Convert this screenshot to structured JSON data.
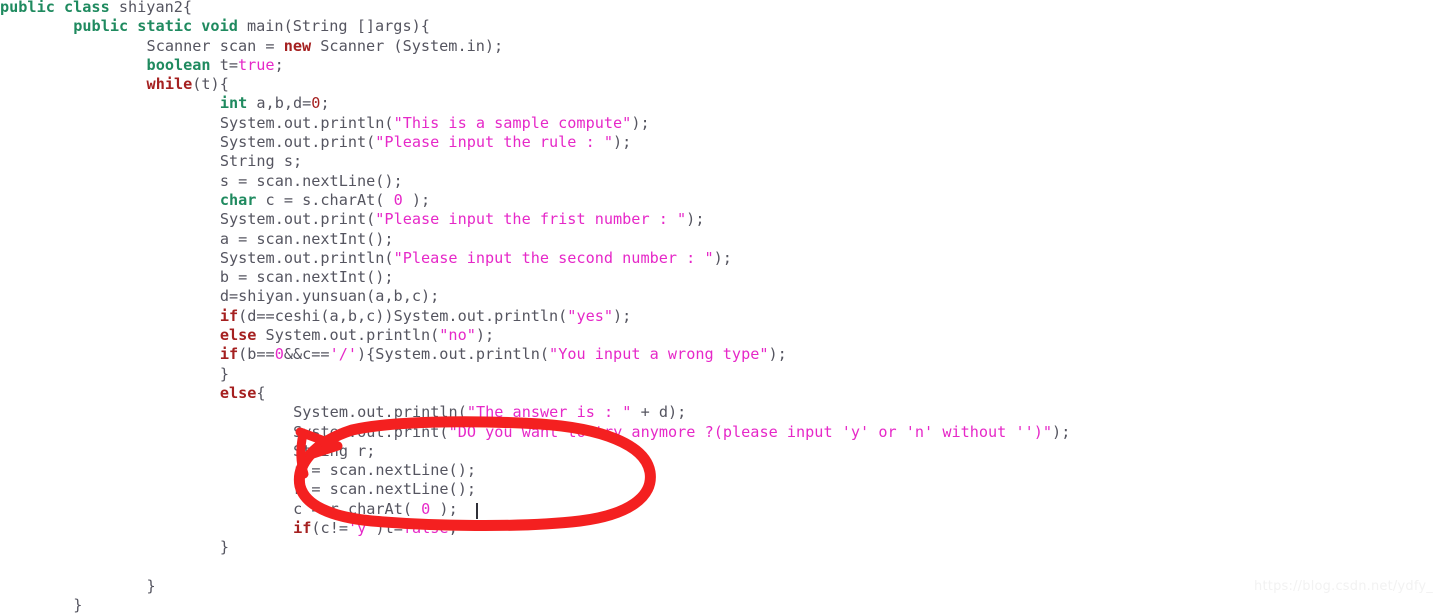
{
  "window": {
    "title": "shiyan2.java",
    "kind": "code-editor-screenshot",
    "background": "#ffffff"
  },
  "theme": {
    "foreground": "#555560",
    "keyword_type": "#1f8a5f",
    "keyword_control": "#a52020",
    "string": "#e628c8",
    "number": "#a52020",
    "caret": "#303038",
    "annotation": "#f42020",
    "watermark": "#f2f2f2"
  },
  "editor": {
    "language": "Java",
    "font_size_px": 15.2,
    "line_height_px": 19.3,
    "caret": {
      "line_index": 27,
      "after_text": "r = scan.nextLine();"
    },
    "lines": [
      {
        "n": 1,
        "indent": 0,
        "text": "public class shiyan2{",
        "tokens": [
          {
            "t": "public class ",
            "c": "kw"
          },
          {
            "t": "shiyan2{",
            "c": "plain"
          }
        ]
      },
      {
        "n": 2,
        "indent": 8,
        "text": "public static void main(String []args){",
        "tokens": [
          {
            "t": "public static void ",
            "c": "kw"
          },
          {
            "t": "main(String []args){",
            "c": "plain"
          }
        ]
      },
      {
        "n": 3,
        "indent": 16,
        "text": "Scanner scan = new Scanner (System.in);",
        "tokens": [
          {
            "t": "Scanner scan = ",
            "c": "plain"
          },
          {
            "t": "new",
            "c": "kw2"
          },
          {
            "t": " Scanner (System.in);",
            "c": "plain"
          }
        ]
      },
      {
        "n": 4,
        "indent": 16,
        "text": "boolean t=true;",
        "tokens": [
          {
            "t": "boolean",
            "c": "kw"
          },
          {
            "t": " t=",
            "c": "plain"
          },
          {
            "t": "true",
            "c": "lit"
          },
          {
            "t": ";",
            "c": "plain"
          }
        ]
      },
      {
        "n": 5,
        "indent": 16,
        "text": "while(t){",
        "tokens": [
          {
            "t": "while",
            "c": "kw2"
          },
          {
            "t": "(t){",
            "c": "plain"
          }
        ]
      },
      {
        "n": 6,
        "indent": 24,
        "text": "int a,b,d=0;",
        "tokens": [
          {
            "t": "int",
            "c": "kw"
          },
          {
            "t": " a,b,d=",
            "c": "plain"
          },
          {
            "t": "0",
            "c": "num"
          },
          {
            "t": ";",
            "c": "plain"
          }
        ]
      },
      {
        "n": 7,
        "indent": 24,
        "text": "System.out.println(\"This is a sample compute\");",
        "tokens": [
          {
            "t": "System.out.println(",
            "c": "plain"
          },
          {
            "t": "\"This is a sample compute\"",
            "c": "str"
          },
          {
            "t": ");",
            "c": "plain"
          }
        ]
      },
      {
        "n": 8,
        "indent": 24,
        "text": "System.out.print(\"Please input the rule : \");",
        "tokens": [
          {
            "t": "System.out.print(",
            "c": "plain"
          },
          {
            "t": "\"Please input the rule : \"",
            "c": "str"
          },
          {
            "t": ");",
            "c": "plain"
          }
        ]
      },
      {
        "n": 9,
        "indent": 24,
        "text": "String s;",
        "tokens": [
          {
            "t": "String s;",
            "c": "plain"
          }
        ]
      },
      {
        "n": 10,
        "indent": 24,
        "text": "s = scan.nextLine();",
        "tokens": [
          {
            "t": "s = scan.nextLine();",
            "c": "plain"
          }
        ]
      },
      {
        "n": 11,
        "indent": 24,
        "text": "char c = s.charAt( 0 );",
        "tokens": [
          {
            "t": "char",
            "c": "kw"
          },
          {
            "t": " c = s.charAt( ",
            "c": "plain"
          },
          {
            "t": "0",
            "c": "numpink"
          },
          {
            "t": " );",
            "c": "plain"
          }
        ]
      },
      {
        "n": 12,
        "indent": 24,
        "text": "System.out.print(\"Please input the frist number : \");",
        "tokens": [
          {
            "t": "System.out.print(",
            "c": "plain"
          },
          {
            "t": "\"Please input the frist number : \"",
            "c": "str"
          },
          {
            "t": ");",
            "c": "plain"
          }
        ]
      },
      {
        "n": 13,
        "indent": 24,
        "text": "a = scan.nextInt();",
        "tokens": [
          {
            "t": "a = scan.nextInt();",
            "c": "plain"
          }
        ]
      },
      {
        "n": 14,
        "indent": 24,
        "text": "System.out.println(\"Please input the second number : \");",
        "tokens": [
          {
            "t": "System.out.println(",
            "c": "plain"
          },
          {
            "t": "\"Please input the second number : \"",
            "c": "str"
          },
          {
            "t": ");",
            "c": "plain"
          }
        ]
      },
      {
        "n": 15,
        "indent": 24,
        "text": "b = scan.nextInt();",
        "tokens": [
          {
            "t": "b = scan.nextInt();",
            "c": "plain"
          }
        ]
      },
      {
        "n": 16,
        "indent": 24,
        "text": "d=shiyan.yunsuan(a,b,c);",
        "tokens": [
          {
            "t": "d=shiyan.yunsuan(a,b,c);",
            "c": "plain"
          }
        ]
      },
      {
        "n": 17,
        "indent": 24,
        "text": "if(d==ceshi(a,b,c))System.out.println(\"yes\");",
        "tokens": [
          {
            "t": "if",
            "c": "kw2"
          },
          {
            "t": "(d==ceshi(a,b,c))System.out.println(",
            "c": "plain"
          },
          {
            "t": "\"yes\"",
            "c": "str"
          },
          {
            "t": ");",
            "c": "plain"
          }
        ]
      },
      {
        "n": 18,
        "indent": 24,
        "text": "else System.out.println(\"no\");",
        "tokens": [
          {
            "t": "else",
            "c": "kw2"
          },
          {
            "t": " System.out.println(",
            "c": "plain"
          },
          {
            "t": "\"no\"",
            "c": "str"
          },
          {
            "t": ");",
            "c": "plain"
          }
        ]
      },
      {
        "n": 19,
        "indent": 24,
        "text": "if(b==0&&c=='/'){System.out.println(\"You input a wrong type\");",
        "tokens": [
          {
            "t": "if",
            "c": "kw2"
          },
          {
            "t": "(b==",
            "c": "plain"
          },
          {
            "t": "0",
            "c": "numpink"
          },
          {
            "t": "&&c==",
            "c": "plain"
          },
          {
            "t": "'/'",
            "c": "str"
          },
          {
            "t": "){System.out.println(",
            "c": "plain"
          },
          {
            "t": "\"You input a wrong type\"",
            "c": "str"
          },
          {
            "t": ");",
            "c": "plain"
          }
        ]
      },
      {
        "n": 20,
        "indent": 24,
        "text": "}",
        "tokens": [
          {
            "t": "}",
            "c": "plain"
          }
        ]
      },
      {
        "n": 21,
        "indent": 24,
        "text": "else{",
        "tokens": [
          {
            "t": "else",
            "c": "kw2"
          },
          {
            "t": "{",
            "c": "plain"
          }
        ]
      },
      {
        "n": 22,
        "indent": 32,
        "text": "System.out.println(\"The answer is : \" + d);",
        "tokens": [
          {
            "t": "System.out.println(",
            "c": "plain"
          },
          {
            "t": "\"The answer is : \"",
            "c": "str"
          },
          {
            "t": " + d);",
            "c": "plain"
          }
        ]
      },
      {
        "n": 23,
        "indent": 32,
        "text": "System.out.print(\"DO you want to try anymore ?(please input 'y' or 'n' without '')\");",
        "tokens": [
          {
            "t": "System.out.print(",
            "c": "plain"
          },
          {
            "t": "\"DO you want to try anymore ?(please input 'y' or 'n' without '')\"",
            "c": "str"
          },
          {
            "t": ");",
            "c": "plain"
          }
        ]
      },
      {
        "n": 24,
        "indent": 32,
        "text": "String r;",
        "tokens": [
          {
            "t": "String r;",
            "c": "plain"
          }
        ]
      },
      {
        "n": 25,
        "indent": 32,
        "text": "r = scan.nextLine();",
        "tokens": [
          {
            "t": "r = scan.nextLine();",
            "c": "plain"
          }
        ]
      },
      {
        "n": 26,
        "indent": 32,
        "text": "r = scan.nextLine();",
        "tokens": [
          {
            "t": "r = scan.nextLine();",
            "c": "plain"
          }
        ]
      },
      {
        "n": 27,
        "indent": 32,
        "text": "c = r.charAt( 0 );",
        "tokens": [
          {
            "t": "c = r.charAt( ",
            "c": "plain"
          },
          {
            "t": "0",
            "c": "numpink"
          },
          {
            "t": " );",
            "c": "plain"
          }
        ]
      },
      {
        "n": 28,
        "indent": 32,
        "text": "if(c!='y')t=false;",
        "tokens": [
          {
            "t": "if",
            "c": "kw2"
          },
          {
            "t": "(c!=",
            "c": "plain"
          },
          {
            "t": "'y'",
            "c": "str"
          },
          {
            "t": ")t=",
            "c": "plain"
          },
          {
            "t": "false",
            "c": "lit"
          },
          {
            "t": ";",
            "c": "plain"
          }
        ]
      },
      {
        "n": 29,
        "indent": 24,
        "text": "}",
        "tokens": [
          {
            "t": "}",
            "c": "plain"
          }
        ]
      },
      {
        "n": 30,
        "indent": 0,
        "text": "",
        "tokens": []
      },
      {
        "n": 31,
        "indent": 16,
        "text": "}",
        "tokens": [
          {
            "t": "}",
            "c": "plain"
          }
        ]
      },
      {
        "n": 32,
        "indent": 8,
        "text": "}",
        "tokens": [
          {
            "t": "}",
            "c": "plain"
          }
        ]
      }
    ]
  },
  "annotation": {
    "kind": "hand-drawn-red-ellipse",
    "color": "#f42020",
    "stroke_width": 11,
    "description": "red circle around the String r / scan.nextLine / charAt block with a pointer tail on the left"
  },
  "watermark": {
    "text": "https://blog.csdn.net/ydfy_"
  }
}
